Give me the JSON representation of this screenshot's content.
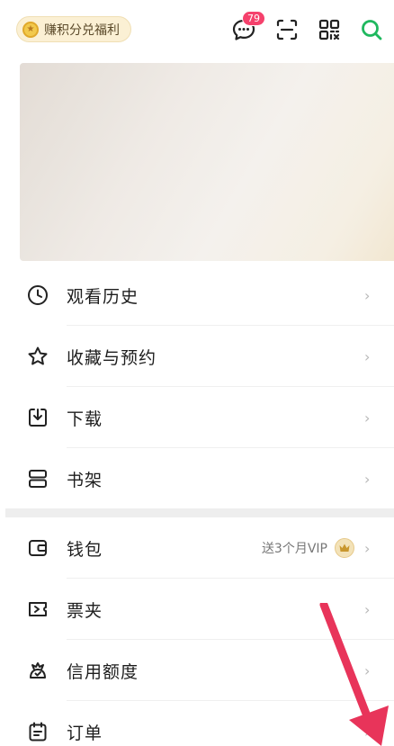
{
  "header": {
    "points_label": "赚积分兑福利",
    "message_count": "79"
  },
  "menu_group_a": [
    {
      "label": "观看历史",
      "icon": "clock-icon"
    },
    {
      "label": "收藏与预约",
      "icon": "star-icon"
    },
    {
      "label": "下载",
      "icon": "download-icon"
    },
    {
      "label": "书架",
      "icon": "bookshelf-icon"
    }
  ],
  "menu_group_b": [
    {
      "label": "钱包",
      "icon": "wallet-icon",
      "extra": "送3个月VIP"
    },
    {
      "label": "票夹",
      "icon": "ticket-icon"
    },
    {
      "label": "信用额度",
      "icon": "credit-icon"
    },
    {
      "label": "订单",
      "icon": "order-icon"
    }
  ],
  "colors": {
    "accent_green": "#1fb85e",
    "badge_red": "#f5416c",
    "overlay_arrow": "#e8345a"
  }
}
